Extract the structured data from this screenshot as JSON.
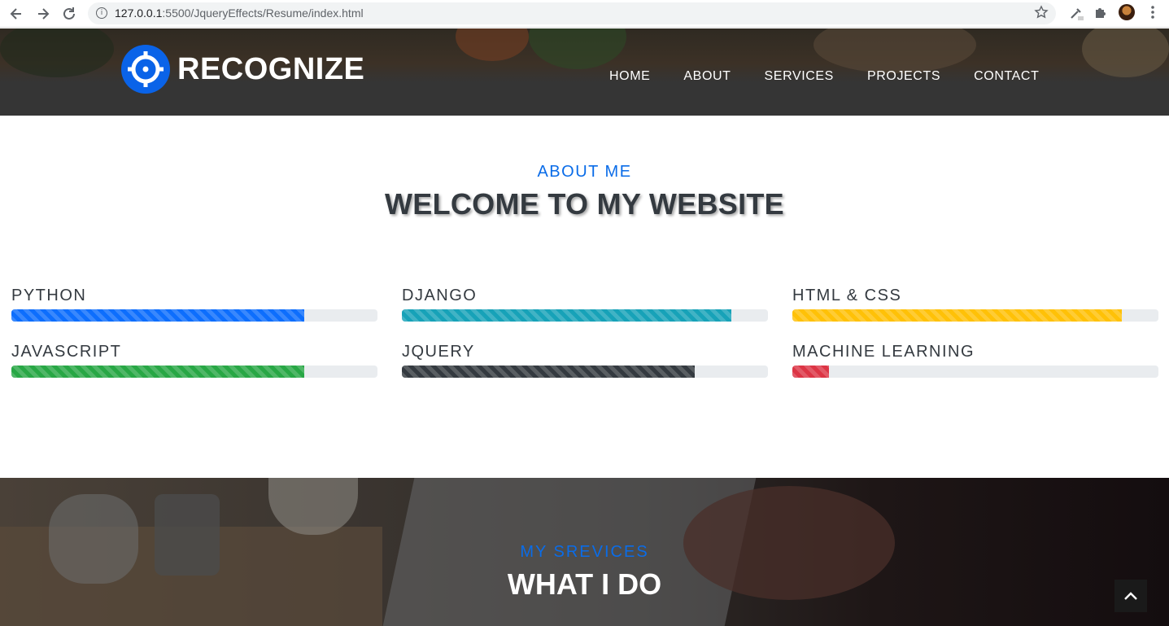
{
  "browser": {
    "url_host": "127.0.0.1",
    "url_rest": ":5500/JqueryEffects/Resume/index.html"
  },
  "header": {
    "brand": "RECOGNIZE",
    "menu": [
      "HOME",
      "ABOUT",
      "SERVICES",
      "PROJECTS",
      "CONTACT"
    ]
  },
  "about": {
    "subtitle": "ABOUT ME",
    "title": "WELCOME TO MY WEBSITE",
    "skills": [
      {
        "label": "PYTHON",
        "percent": 80,
        "color": "#0d6efd"
      },
      {
        "label": "DJANGO",
        "percent": 90,
        "color": "#17a2b8"
      },
      {
        "label": "HTML & CSS",
        "percent": 90,
        "color": "#ffc107"
      },
      {
        "label": "JAVASCRIPT",
        "percent": 80,
        "color": "#28a745"
      },
      {
        "label": "JQUERY",
        "percent": 80,
        "color": "#343a40"
      },
      {
        "label": "MACHINE LEARNING",
        "percent": 10,
        "color": "#dc3545"
      }
    ]
  },
  "services": {
    "subtitle": "MY SREVICES",
    "title": "WHAT I DO"
  },
  "icons": {
    "back": "arrow-left-icon",
    "forward": "arrow-right-icon",
    "reload": "reload-icon",
    "info": "info-icon",
    "star": "star-icon",
    "eyedropper": "eyedropper-icon",
    "extensions": "puzzle-icon",
    "menu": "kebab-menu-icon",
    "scroll_top": "chevron-up-icon"
  }
}
